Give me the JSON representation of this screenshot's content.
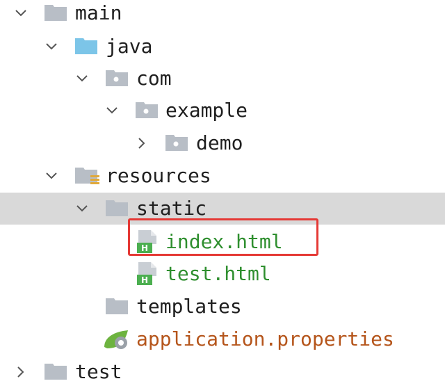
{
  "tree": {
    "items": [
      {
        "label": "main",
        "kind": "folder",
        "expanded": true
      },
      {
        "label": "java",
        "kind": "source-folder",
        "expanded": true
      },
      {
        "label": "com",
        "kind": "package",
        "expanded": true
      },
      {
        "label": "example",
        "kind": "package",
        "expanded": true
      },
      {
        "label": "demo",
        "kind": "package",
        "expanded": false
      },
      {
        "label": "resources",
        "kind": "resources-folder",
        "expanded": true
      },
      {
        "label": "static",
        "kind": "folder",
        "expanded": true,
        "selected": true
      },
      {
        "label": "index.html",
        "kind": "html-file",
        "highlighted": true
      },
      {
        "label": "test.html",
        "kind": "html-file"
      },
      {
        "label": "templates",
        "kind": "folder"
      },
      {
        "label": "application.properties",
        "kind": "properties-file"
      },
      {
        "label": "test",
        "kind": "folder",
        "expanded": false
      }
    ]
  },
  "colors": {
    "folder": "#b8bec6",
    "source_folder": "#7cc5e8",
    "html_label": "#2f8f2f",
    "properties_label": "#b5551b",
    "highlight_border": "#e53935",
    "selection": "#d9d9d9"
  }
}
